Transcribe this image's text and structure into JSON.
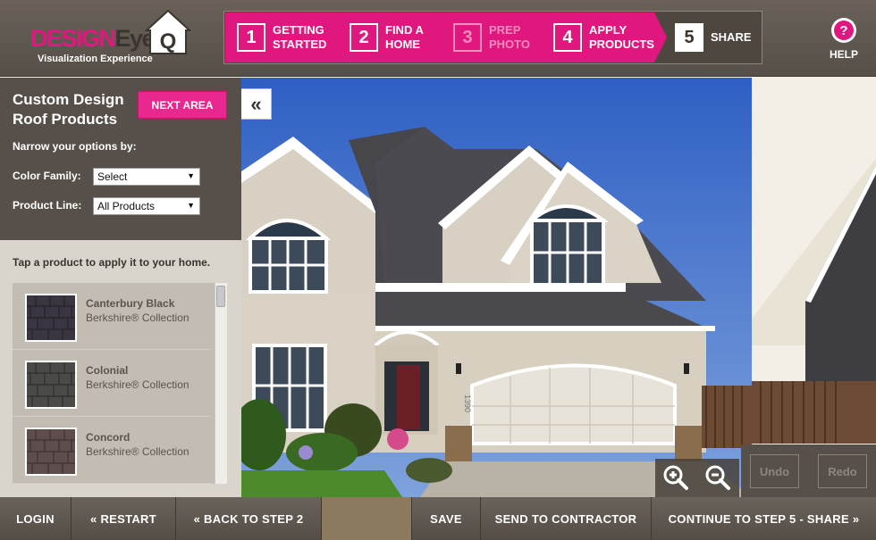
{
  "brand": {
    "name_part1": "DESIGN",
    "name_part2": "Eye",
    "mark": "Q",
    "tagline": "Visualization Experience"
  },
  "steps": [
    {
      "num": "1",
      "label": "GETTING STARTED"
    },
    {
      "num": "2",
      "label": "FIND A HOME"
    },
    {
      "num": "3",
      "label": "PREP PHOTO"
    },
    {
      "num": "4",
      "label": "APPLY PRODUCTS"
    },
    {
      "num": "5",
      "label": "SHARE"
    }
  ],
  "help": {
    "label": "HELP",
    "icon": "?"
  },
  "panel": {
    "title_line1": "Custom Design",
    "title_line2": "Roof Products",
    "next_area": "NEXT AREA",
    "narrow": "Narrow your options by:",
    "color_family_label": "Color Family:",
    "color_family_value": "Select",
    "product_line_label": "Product Line:",
    "product_line_value": "All Products",
    "collapse_icon": "«",
    "tap_text": "Tap a product to apply it to your home."
  },
  "products": [
    {
      "name": "Canterbury Black",
      "line": "Berkshire® Collection",
      "color": "#3a3540"
    },
    {
      "name": "Colonial",
      "line": "Berkshire® Collection",
      "color": "#4a4a46"
    },
    {
      "name": "Concord",
      "line": "Berkshire® Collection",
      "color": "#5e4d4c"
    }
  ],
  "house": {
    "number": "1390"
  },
  "controls": {
    "undo": "Undo",
    "redo": "Redo"
  },
  "bottom": {
    "login": "LOGIN",
    "restart": "« RESTART",
    "back": "« BACK TO STEP 2",
    "save": "SAVE",
    "send": "SEND TO CONTRACTOR",
    "continue": "CONTINUE TO STEP 5 - SHARE »"
  },
  "colors": {
    "accent": "#e0177e",
    "panel": "#57504a",
    "sky": "#3f6bc7"
  }
}
